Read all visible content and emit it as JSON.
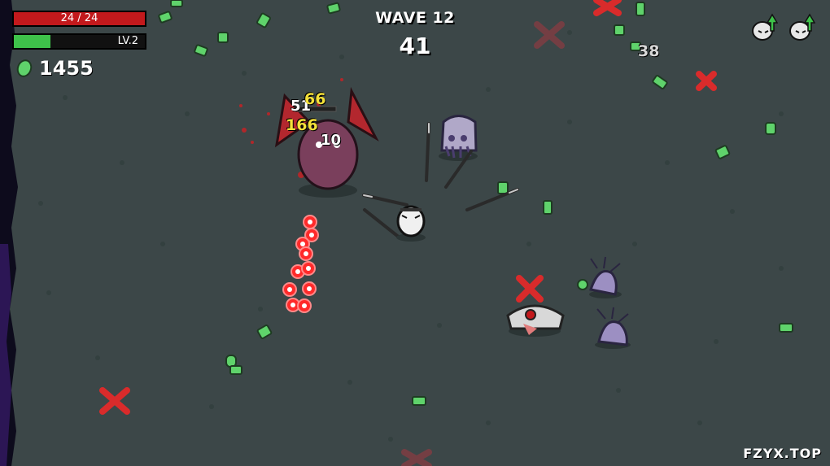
{
  "hud": {
    "hp_text": "24 / 24",
    "hp_fraction": 1.0,
    "level_text": "LV.2",
    "xp_fraction": 0.28,
    "materials": "1455"
  },
  "wave": {
    "title": "WAVE 12",
    "timer": "41"
  },
  "damage_numbers": [
    "51",
    "66",
    "166",
    "10",
    "38"
  ],
  "watermark": "FZYX.TOP",
  "colors": {
    "ground": "#3c4748",
    "hp": "#c3191c",
    "xp": "#3ec24a",
    "material": "#5fd36b",
    "crit_text": "#f4e13a",
    "enemy_marker": "#d92b2b",
    "projectile": "#ff2a2a"
  },
  "icons": {
    "materials": "material-icon",
    "level_up": "level-up-icon",
    "spawn_marker": "spawn-cross-icon"
  }
}
